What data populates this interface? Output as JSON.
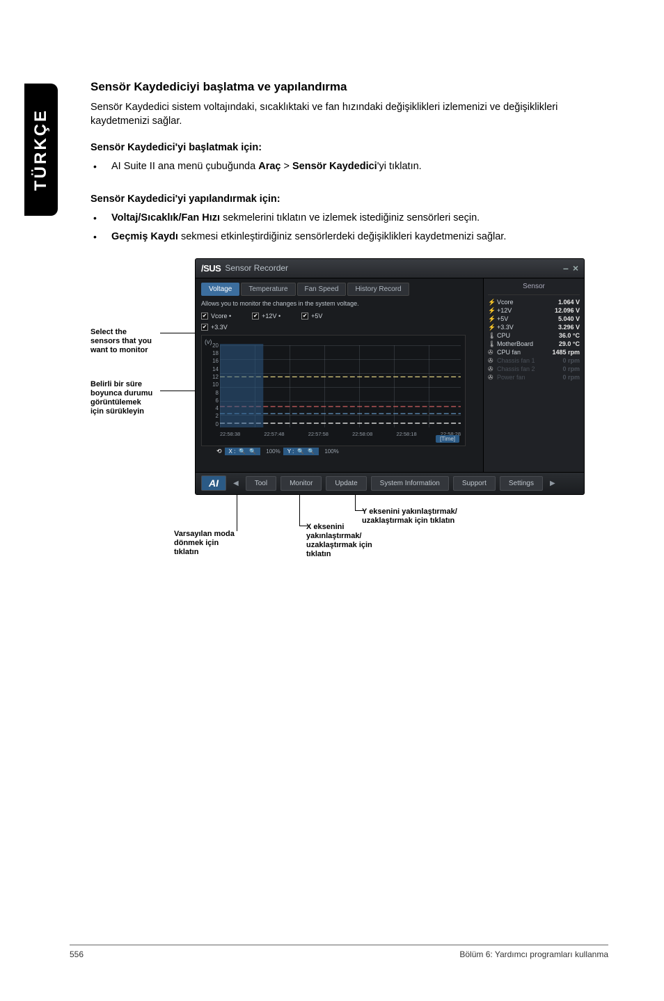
{
  "sideTab": "TÜRKÇE",
  "heading1": "Sensör Kaydediciyi başlatma ve yapılandırma",
  "intro": "Sensör Kaydedici sistem voltajındaki, sıcaklıktaki ve fan hızındaki değişiklikleri izlemenizi ve değişiklikleri kaydetmenizi sağlar.",
  "heading2a": "Sensör Kaydedici'yi başlatmak için:",
  "bullet1_pre": "AI Suite II ana menü çubuğunda ",
  "bullet1_bold1": "Araç",
  "bullet1_mid": " > ",
  "bullet1_bold2": "Sensör Kaydedici",
  "bullet1_post": "'yi tıklatın.",
  "heading2b": "Sensör Kaydedici'yi yapılandırmak için:",
  "bullet2_bold": "Voltaj/Sıcaklık/Fan Hızı ",
  "bullet2_rest": "sekmelerini tıklatın ve izlemek istediğiniz sensörleri seçin.",
  "bullet3_bold": "Geçmiş Kaydı ",
  "bullet3_rest": "sekmesi etkinleştirdiğiniz sensörlerdeki değişiklikleri kaydetmenizi sağlar.",
  "callouts": {
    "selectSensors": "Select the\nsensors that you\nwant to monitor",
    "dragDuration": "Belirli bir süre\nboyunca durumu\ngörüntülemek\niçin sürükleyin",
    "defaultReturn": "Varsayılan moda\ndönmek için\ntıklatın",
    "xZoom": "X eksenini\nyakınlaştırmak/\nuzaklaştırmak için\ntıklatın",
    "yZoom": "Y eksenini yakınlaştırmak/\nuzaklaştırmak için tıklatın"
  },
  "window": {
    "brand": "/SUS",
    "title": "Sensor Recorder",
    "tabs": [
      "Voltage",
      "Temperature",
      "Fan Speed",
      "History Record"
    ],
    "desc": "Allows you to monitor the changes in the system voltage.",
    "checks": [
      {
        "label": "Vcore •",
        "on": true,
        "color": "#ffffff"
      },
      {
        "label": "+12V •",
        "on": true,
        "color": "#ffffff"
      },
      {
        "label": "+5V",
        "on": true,
        "color": "#ffffff"
      },
      {
        "label": "+3.3V",
        "on": true,
        "color": "#ffffff"
      }
    ],
    "ylabel": "(v)",
    "yticks": [
      "20",
      "18",
      "16",
      "14",
      "12",
      "10",
      "8",
      "6",
      "4",
      "2",
      "0"
    ],
    "xticks": [
      "22:58:38",
      "22:57:48",
      "22:57:58",
      "22:58:08",
      "22:58:18",
      "22:58:28"
    ],
    "timed": "[Time]",
    "zoomX": "100%",
    "zoomY": "100%",
    "sensorHeader": "Sensor",
    "sensors": [
      {
        "icon": "bolt",
        "label": "Vcore",
        "value": "1.064 V",
        "dim": false
      },
      {
        "icon": "bolt",
        "label": "+12V",
        "value": "12.096 V",
        "dim": false
      },
      {
        "icon": "bolt",
        "label": "+5V",
        "value": "5.040 V",
        "dim": false
      },
      {
        "icon": "bolt",
        "label": "+3.3V",
        "value": "3.296 V",
        "dim": false
      },
      {
        "icon": "thermo",
        "label": "CPU",
        "value": "36.0 °C",
        "dim": false
      },
      {
        "icon": "thermo",
        "label": "MotherBoard",
        "value": "29.0 °C",
        "dim": false
      },
      {
        "icon": "fan",
        "label": "CPU fan",
        "value": "1485 rpm",
        "dim": false
      },
      {
        "icon": "fan",
        "label": "Chassis fan 1",
        "value": "0 rpm",
        "dim": true
      },
      {
        "icon": "fan",
        "label": "Chassis fan 2",
        "value": "0 rpm",
        "dim": true
      },
      {
        "icon": "fan",
        "label": "Power fan",
        "value": "0 rpm",
        "dim": true
      }
    ],
    "bottom": [
      "Tool",
      "Monitor",
      "Update",
      "System Information",
      "Support",
      "Settings"
    ]
  },
  "chart_data": {
    "type": "line",
    "title": "System voltage over time",
    "xlabel": "Time",
    "ylabel": "(v)",
    "ylim": [
      0,
      20
    ],
    "categories": [
      "22:58:38",
      "22:57:48",
      "22:57:58",
      "22:58:08",
      "22:58:18",
      "22:58:28"
    ],
    "series": [
      {
        "name": "Vcore",
        "values": [
          1.0,
          1.0,
          1.0,
          1.0,
          1.0,
          1.0
        ]
      },
      {
        "name": "+12V",
        "values": [
          12.1,
          12.1,
          12.1,
          12.1,
          12.1,
          12.1
        ]
      },
      {
        "name": "+5V",
        "values": [
          5.0,
          5.0,
          5.0,
          5.0,
          5.0,
          5.0
        ]
      },
      {
        "name": "+3.3V",
        "values": [
          3.3,
          3.3,
          3.3,
          3.3,
          3.3,
          3.3
        ]
      }
    ]
  },
  "footer": {
    "page": "556",
    "chapter": "Bölüm 6:  Yardımcı programları kullanma"
  }
}
